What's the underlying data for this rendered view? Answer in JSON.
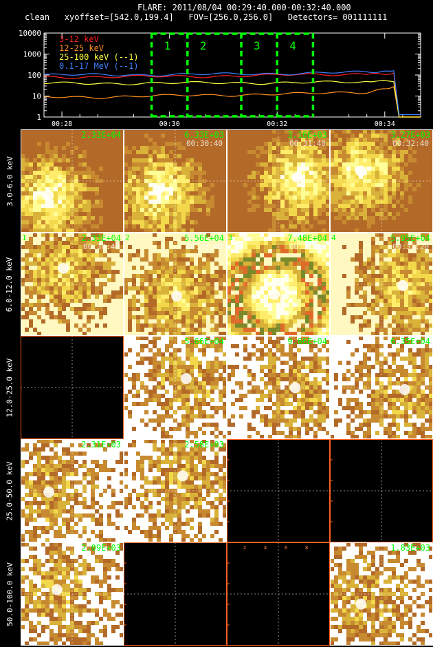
{
  "header": {
    "line1": "FLARE: 2011/08/04 00:29:40.000-00:32:40.000",
    "line2": "clean   xyoffset=[542.0,199.4]   FOV=[256.0,256.0]   Detectors= 001111111"
  },
  "chart_data": [
    {
      "type": "line",
      "yscale": "log",
      "ylim": [
        1,
        10000
      ],
      "yticks": [
        "1",
        "10",
        "100",
        "1000",
        "10000"
      ],
      "xlim": [
        "00:27:40",
        "00:34:40"
      ],
      "xticks": [
        "00:28",
        "00:30",
        "00:32",
        "00:34"
      ],
      "series": [
        {
          "name": "3-12 keV",
          "color": "#ff2020",
          "x": [
            "00:27:40",
            "00:28:40",
            "00:29:40",
            "00:30:40",
            "00:31:40",
            "00:32:40",
            "00:33:40",
            "00:34:10",
            "00:34:16",
            "00:34:40"
          ],
          "y": [
            80,
            82,
            84,
            88,
            95,
            105,
            115,
            125,
            1,
            1
          ]
        },
        {
          "name": "12-25 keV",
          "color": "#ff9020",
          "x": [
            "00:27:40",
            "00:28:40",
            "00:29:40",
            "00:30:40",
            "00:31:40",
            "00:32:40",
            "00:33:40",
            "00:34:10",
            "00:34:16",
            "00:34:40"
          ],
          "y": [
            9,
            9,
            10,
            11,
            12,
            13,
            16,
            28,
            1,
            1
          ]
        },
        {
          "name": "25-100 keV (--1)",
          "color": "#ffff40",
          "x": [
            "00:27:40",
            "00:28:40",
            "00:29:40",
            "00:30:40",
            "00:31:40",
            "00:32:40",
            "00:33:40",
            "00:34:10",
            "00:34:16",
            "00:34:40"
          ],
          "y": [
            40,
            40,
            41,
            42,
            43,
            44,
            46,
            48,
            1,
            1
          ]
        },
        {
          "name": "0.1-17 MeV (--1)",
          "color": "#4080ff",
          "x": [
            "00:27:40",
            "00:28:40",
            "00:29:40",
            "00:30:40",
            "00:31:40",
            "00:32:40",
            "00:33:40",
            "00:34:10",
            "00:34:16",
            "00:34:40"
          ],
          "y": [
            100,
            102,
            104,
            108,
            115,
            125,
            135,
            160,
            1.3,
            1.3
          ]
        }
      ],
      "intervals": [
        {
          "label": "1",
          "start": "00:29:40",
          "end": "00:30:20"
        },
        {
          "label": "2",
          "start": "00:30:20",
          "end": "00:31:20"
        },
        {
          "label": "3",
          "start": "00:31:20",
          "end": "00:32:00"
        },
        {
          "label": "4",
          "start": "00:32:00",
          "end": "00:32:40"
        }
      ],
      "legend": "top-left",
      "interval_color": "#00ff00"
    },
    {
      "type": "heatmap",
      "rows": [
        "3.0-6.0 keV",
        "6.0-12.0 keV",
        "12.0-25.0 keV",
        "25.0-50.0 keV",
        "50.0-100.0 keV"
      ],
      "columns": [
        "1",
        "2",
        "3",
        "4"
      ],
      "cells": [
        [
          {
            "peak": "2.33E+04",
            "interval": "",
            "time": ""
          },
          {
            "peak": "6.33E+03",
            "interval": "",
            "time": "00:30:40"
          },
          {
            "peak": "3.16E+03",
            "interval": "",
            "time": "00:31:40"
          },
          {
            "peak": "3.27E+03",
            "interval": "",
            "time": "00:32:40"
          }
        ],
        [
          {
            "peak": "2.33E+04",
            "interval": "1",
            "time": "00:30:40"
          },
          {
            "peak": "5.56E+04",
            "interval": "2",
            "time": "00:31:40"
          },
          {
            "peak": "7.48E+04",
            "interval": "3",
            "time": "00:32:40"
          },
          {
            "peak": "5.95E+04",
            "interval": "4",
            "time": "00:33:20"
          }
        ],
        [
          {
            "empty": true
          },
          {
            "peak": "5.66E+04",
            "interval": "",
            "time": ""
          },
          {
            "peak": "9.66E+04",
            "interval": "",
            "time": ""
          },
          {
            "peak": "6.35E+04",
            "interval": "",
            "time": ""
          }
        ],
        [
          {
            "peak": "2.31E+03",
            "interval": "",
            "time": ""
          },
          {
            "peak": "2.58E+03",
            "interval": "",
            "time": ""
          },
          {
            "empty": true
          },
          {
            "empty": true
          }
        ],
        [
          {
            "peak": "2.09E+03",
            "interval": "",
            "time": ""
          },
          {
            "empty": true
          },
          {
            "empty": true
          },
          {
            "peak": "1.83E+03",
            "interval": "",
            "time": ""
          }
        ]
      ],
      "empty_axis_ticks": [
        "2",
        "4",
        "6",
        "8"
      ],
      "colors": {
        "background": "#000000",
        "cell_border": "#ffffff",
        "peak_text": "#00ff00"
      }
    }
  ]
}
